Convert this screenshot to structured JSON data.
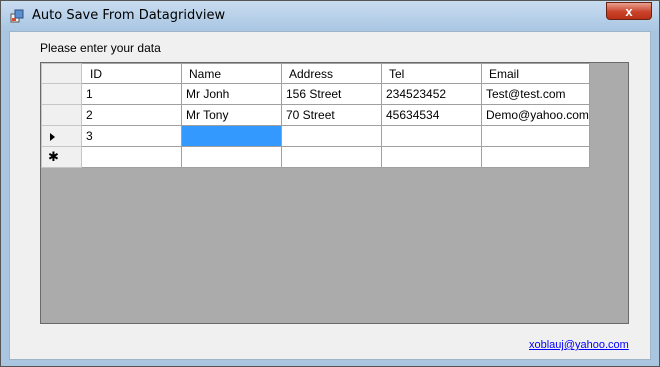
{
  "window": {
    "title": "Auto Save From Datagridview",
    "close_glyph": "x"
  },
  "form": {
    "prompt": "Please enter your data",
    "footer_link": "xoblauj@yahoo.com"
  },
  "grid": {
    "columns": [
      "ID",
      "Name",
      "Address",
      "Tel",
      "Email"
    ],
    "rows": [
      [
        "1",
        "Mr Jonh",
        "156 Street",
        "234523452",
        "Test@test.com"
      ],
      [
        "2",
        "Mr Tony",
        "70 Street",
        "45634534",
        "Demo@yahoo.com"
      ],
      [
        "3",
        "",
        "",
        "",
        ""
      ],
      [
        "",
        "",
        "",
        "",
        ""
      ]
    ],
    "row_indicators": [
      "",
      "",
      "arrow-icon",
      "new-row-icon"
    ],
    "new_row_glyph": "✱"
  },
  "icons": {
    "app": "app-icon",
    "close": "close-icon"
  }
}
